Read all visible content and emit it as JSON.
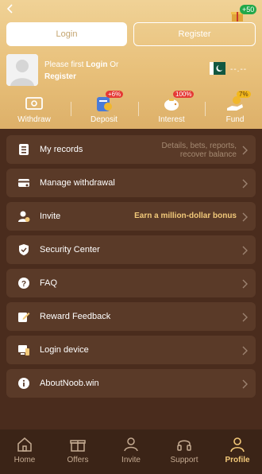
{
  "header": {
    "gift_badge": "+50",
    "login_label": "Login",
    "register_label": "Register",
    "prompt_prefix": "Please first ",
    "prompt_login": "Login",
    "prompt_or": " Or",
    "prompt_register": "Register",
    "balance": "--.--"
  },
  "actions": [
    {
      "label": "Withdraw",
      "icon": "wallet-icon",
      "badge": ""
    },
    {
      "label": "Deposit",
      "icon": "deposit-icon",
      "badge": "+6%"
    },
    {
      "label": "Interest",
      "icon": "piggy-bank-icon",
      "badge": "100%"
    },
    {
      "label": "Fund",
      "icon": "fund-hand-icon",
      "badge": "7%"
    }
  ],
  "menu": [
    {
      "label": "My records",
      "icon": "records-icon",
      "sub": "Details, bets, reports, recover balance"
    },
    {
      "label": "Manage withdrawal",
      "icon": "card-icon"
    },
    {
      "label": "Invite",
      "icon": "invite-user-icon",
      "bonus": "Earn a million-dollar bonus"
    },
    {
      "label": "Security Center",
      "icon": "shield-icon"
    },
    {
      "label": "FAQ",
      "icon": "question-icon"
    },
    {
      "label": "Reward Feedback",
      "icon": "feedback-edit-icon"
    },
    {
      "label": "Login device",
      "icon": "device-icon"
    },
    {
      "label": "AboutNoob.win",
      "icon": "info-icon"
    }
  ],
  "tabs": [
    {
      "label": "Home",
      "icon": "home-icon"
    },
    {
      "label": "Offers",
      "icon": "gift-icon"
    },
    {
      "label": "Invite",
      "icon": "people-icon"
    },
    {
      "label": "Support",
      "icon": "headset-icon"
    },
    {
      "label": "Profile",
      "icon": "profile-icon"
    }
  ],
  "colors": {
    "accent": "#f3c979",
    "header": "#e8c07a",
    "background": "#4a2c1d",
    "card": "#5a3a28"
  }
}
